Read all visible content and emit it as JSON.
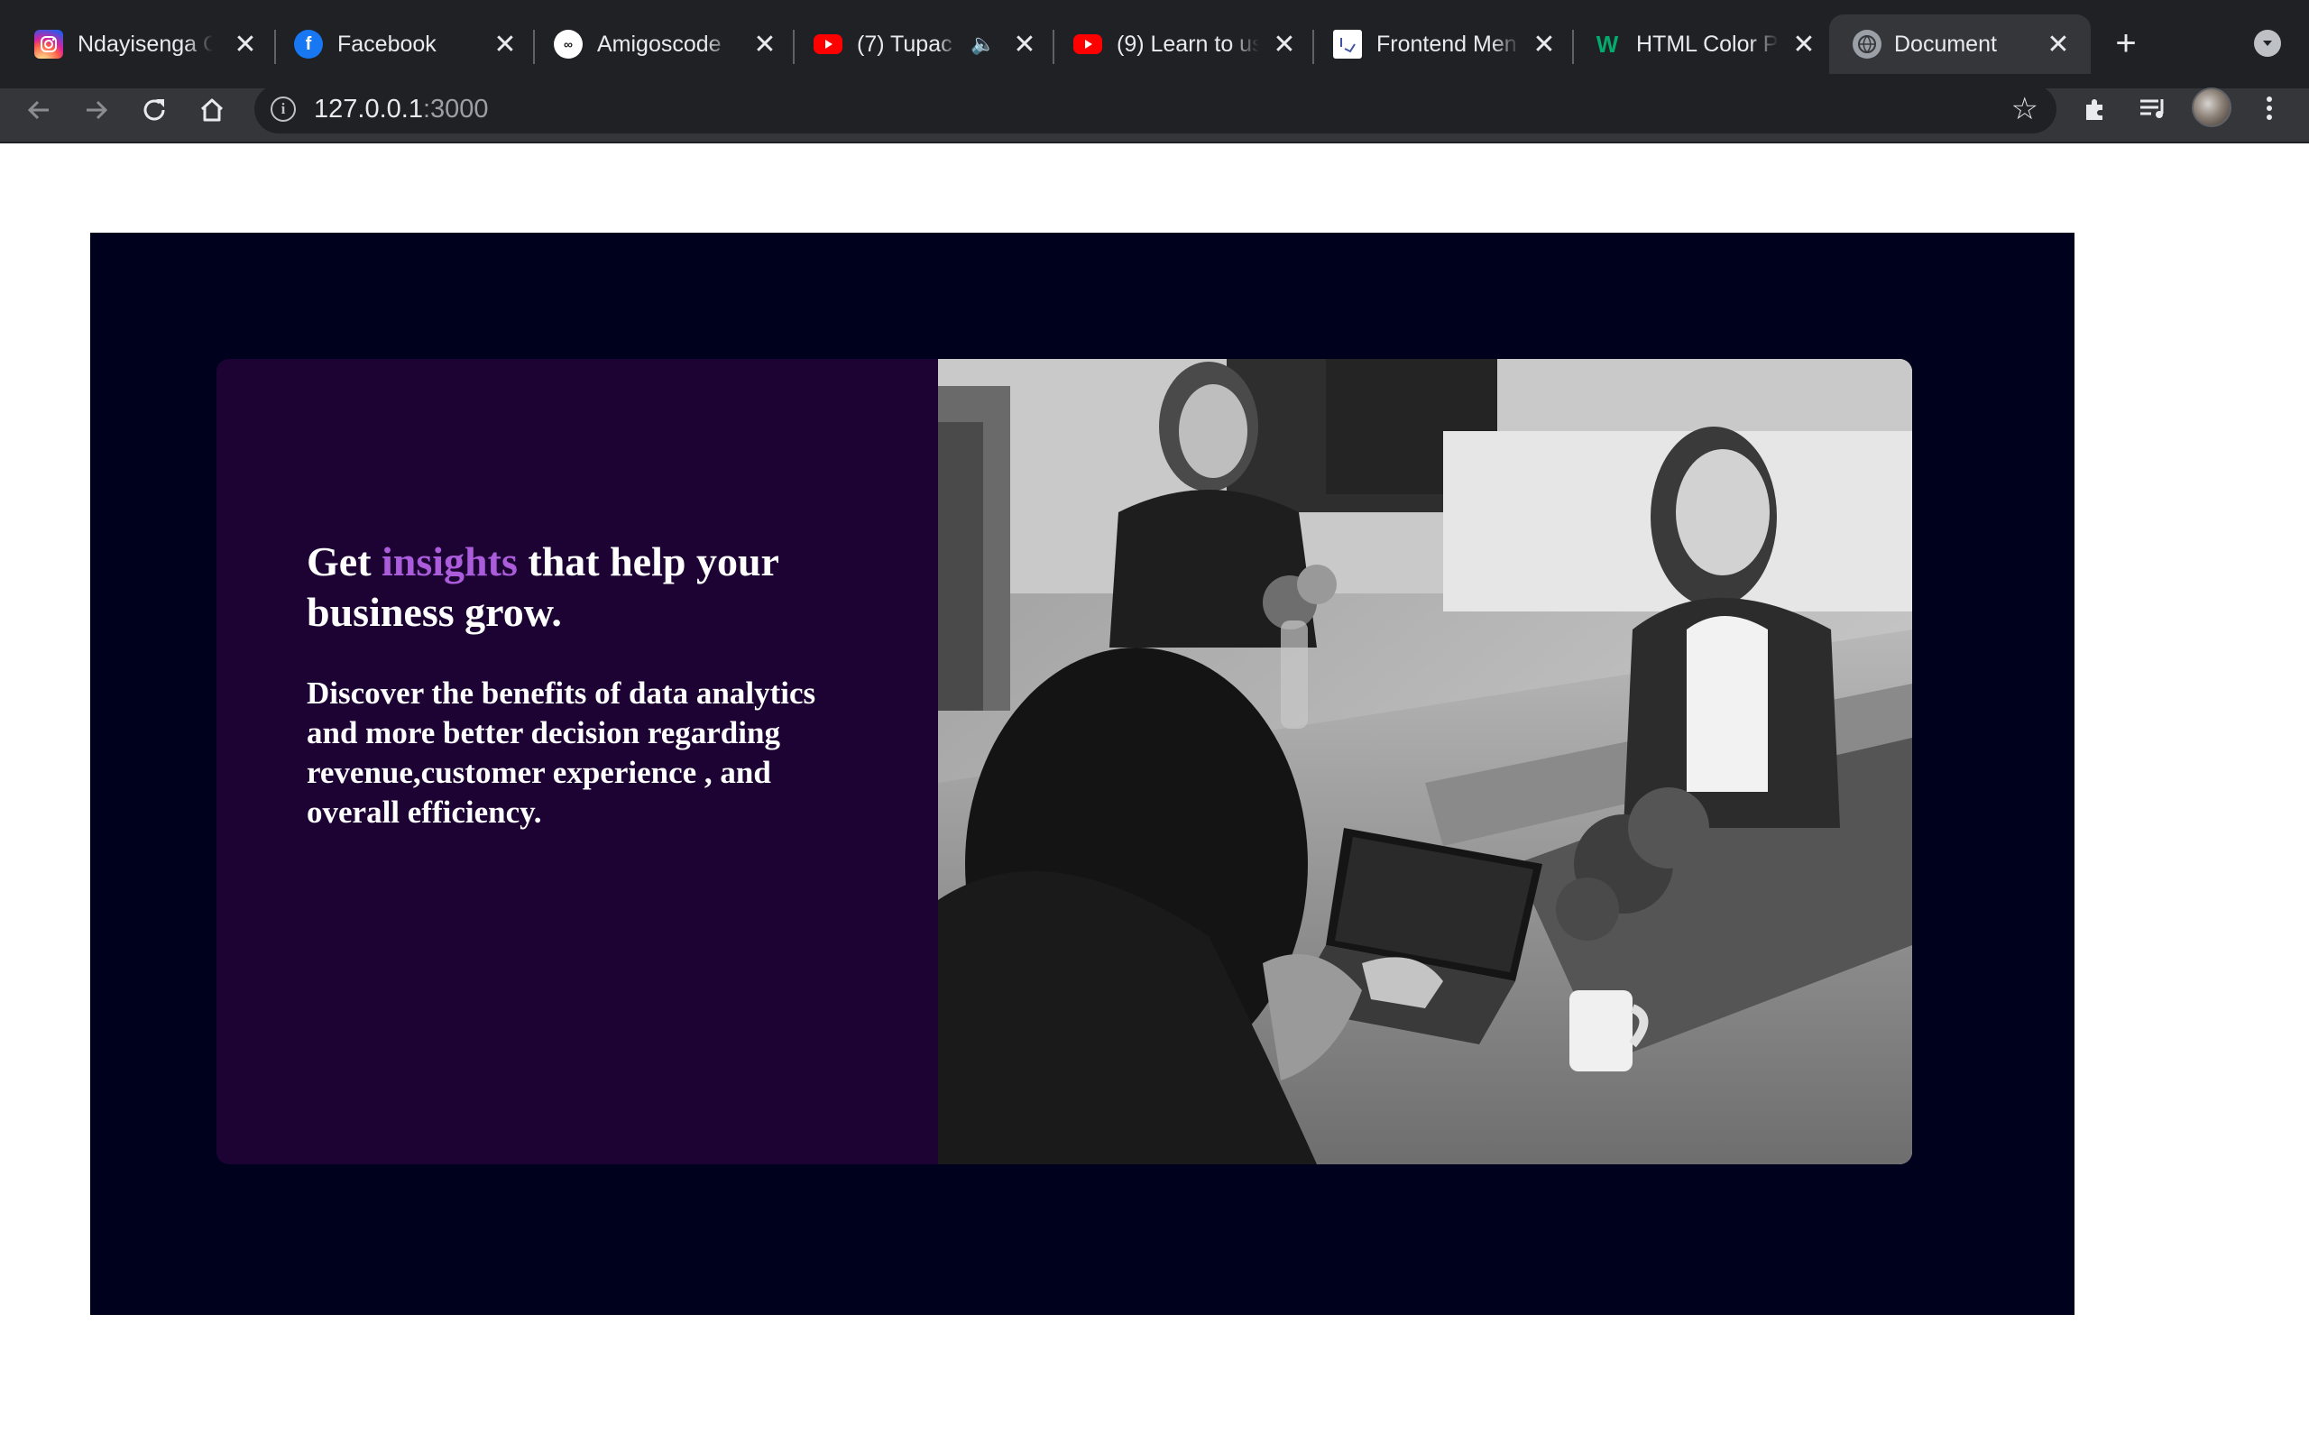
{
  "browser": {
    "tabs": [
      {
        "title": "Ndayisenga Cl",
        "icon": "instagram-icon"
      },
      {
        "title": "Facebook",
        "icon": "facebook-icon"
      },
      {
        "title": "Amigoscode",
        "icon": "amigoscode-icon"
      },
      {
        "title": "(7) Tupac",
        "icon": "youtube-icon"
      },
      {
        "title": "(9) Learn to us",
        "icon": "youtube-icon"
      },
      {
        "title": "Frontend Men",
        "icon": "frontend-mentor-icon"
      },
      {
        "title": "HTML Color P",
        "icon": "w3schools-icon"
      },
      {
        "title": "Document",
        "icon": "globe-icon",
        "active": true
      }
    ],
    "address": {
      "host": "127.0.0.1",
      "port": ":3000"
    }
  },
  "page": {
    "headline": {
      "before": "Get ",
      "accent": "insights",
      "after": " that help your business grow."
    },
    "body": "Discover the benefits of data analytics and more better decision regarding revenue,customer experience , and overall efficiency.",
    "colors": {
      "outer_bg": "#00011c",
      "card_bg": "#1c0333",
      "accent": "#aa5cdb",
      "text": "#ffffff"
    }
  }
}
